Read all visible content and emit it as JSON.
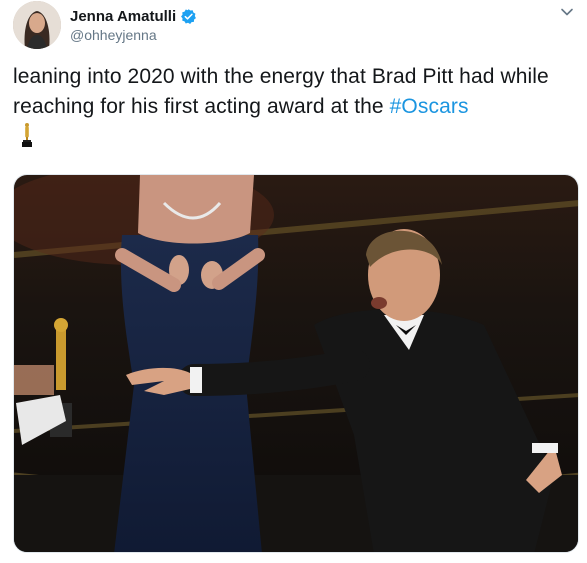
{
  "tweet": {
    "author": {
      "display_name": "Jenna Amatulli",
      "handle": "@ohheyjenna",
      "verified": true,
      "avatar_icon": "profile-photo"
    },
    "text_before_hashtag": "leaning into 2020 with the energy that Brad Pitt had while reaching for his first acting award at the ",
    "hashtag": "#Oscars",
    "emoji_icon": "oscar-statuette-icon",
    "media": {
      "icon": "photo",
      "description_icon": "award-ceremony-photo"
    },
    "colors": {
      "text": "#14171a",
      "secondary": "#657786",
      "link": "#1b95e0",
      "verified": "#1da1f2"
    }
  }
}
